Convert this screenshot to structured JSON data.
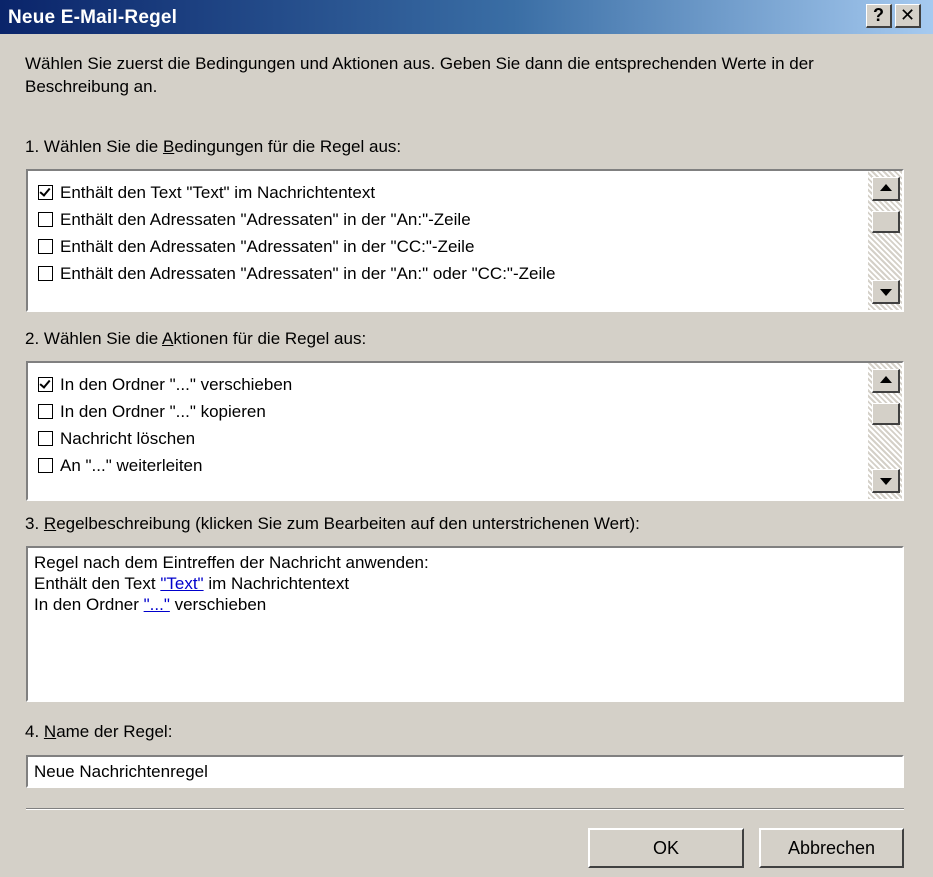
{
  "window": {
    "title": "Neue E-Mail-Regel",
    "help_glyph": "?",
    "close_glyph": "✕"
  },
  "intro_text": "Wählen Sie zuerst die Bedingungen und Aktionen aus. Geben Sie dann die entsprechenden Werte in der Beschreibung an.",
  "step1": {
    "pre": "1. Wählen Sie die ",
    "accel": "B",
    "post": "edingungen für die Regel aus:",
    "items": [
      {
        "label": "Enthält den Text \"Text\" im Nachrichtentext",
        "checked": true
      },
      {
        "label": "Enthält den Adressaten \"Adressaten\" in der \"An:\"-Zeile",
        "checked": false
      },
      {
        "label": "Enthält den Adressaten \"Adressaten\" in der \"CC:\"-Zeile",
        "checked": false
      },
      {
        "label": "Enthält den Adressaten \"Adressaten\" in der \"An:\" oder \"CC:\"-Zeile",
        "checked": false
      }
    ]
  },
  "step2": {
    "pre": "2. Wählen Sie die ",
    "accel": "A",
    "post": "ktionen für die Regel aus:",
    "items": [
      {
        "label": "In den Ordner \"...\" verschieben",
        "checked": true
      },
      {
        "label": "In den Ordner \"...\" kopieren",
        "checked": false
      },
      {
        "label": "Nachricht löschen",
        "checked": false
      },
      {
        "label": "An \"...\" weiterleiten",
        "checked": false
      }
    ]
  },
  "step3": {
    "pre": "3. ",
    "accel": "R",
    "post": "egelbeschreibung (klicken Sie zum Bearbeiten auf den unterstrichenen Wert):",
    "line1": "Regel nach dem Eintreffen der Nachricht anwenden:",
    "line2_pre": "Enthält den Text ",
    "line2_link": "\"Text\"",
    "line2_post": " im Nachrichtentext",
    "line3_pre": "In den Ordner ",
    "line3_link": "\"...\"",
    "line3_post": " verschieben"
  },
  "step4": {
    "pre": "4. ",
    "accel": "N",
    "post": "ame der Regel:",
    "value": "Neue Nachrichtenregel"
  },
  "buttons": {
    "ok": "OK",
    "cancel": "Abbrechen"
  },
  "colors": {
    "title_gradient_start": "#0a246a",
    "title_gradient_end": "#a6caf0",
    "dialog_face": "#d4d0c8",
    "link": "#0000cc"
  }
}
